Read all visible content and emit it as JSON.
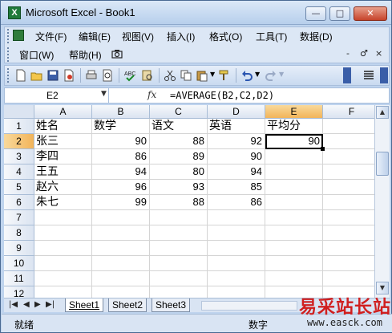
{
  "window": {
    "title": "Microsoft Excel - Book1",
    "minimize_label": "—",
    "restore_label": "□",
    "close_label": "✕",
    "app_icon_letter": "X"
  },
  "menu": {
    "row1": [
      "文件(F)",
      "编辑(E)",
      "视图(V)",
      "插入(I)",
      "格式(O)",
      "工具(T)",
      "数据(D)"
    ],
    "row2": [
      "窗口(W)",
      "帮助(H)"
    ],
    "doc_controls": [
      "-",
      "♂",
      "×"
    ]
  },
  "toolbar": {
    "icons": [
      "new-icon",
      "open-icon",
      "save-icon",
      "permission-icon",
      "print-icon",
      "print-preview-icon",
      "spelling-icon",
      "research-icon",
      "cut-icon",
      "copy-icon",
      "paste-icon",
      "format-painter-icon",
      "undo-icon",
      "redo-icon",
      "align-icon"
    ]
  },
  "formula_bar": {
    "name_box": "E2",
    "fx_label": "fx",
    "formula": "=AVERAGE(B2,C2,D2)"
  },
  "sheet": {
    "columns": [
      "A",
      "B",
      "C",
      "D",
      "E",
      "F"
    ],
    "active_column": "E",
    "active_row": "2",
    "row_numbers": [
      "1",
      "2",
      "3",
      "4",
      "5",
      "6",
      "7",
      "8",
      "9",
      "10",
      "11",
      "12"
    ],
    "header_row": [
      "姓名",
      "数学",
      "语文",
      "英语",
      "平均分",
      ""
    ],
    "rows": [
      [
        "张三",
        "90",
        "88",
        "92",
        "90"
      ],
      [
        "李四",
        "86",
        "89",
        "90",
        ""
      ],
      [
        "王五",
        "94",
        "80",
        "94",
        ""
      ],
      [
        "赵六",
        "96",
        "93",
        "85",
        ""
      ],
      [
        "朱七",
        "99",
        "88",
        "86",
        ""
      ]
    ]
  },
  "tabs": {
    "nav": [
      "|◀",
      "◀",
      "▶",
      "▶|"
    ],
    "sheets": [
      "Sheet1",
      "Sheet2",
      "Sheet3"
    ],
    "active": "Sheet1"
  },
  "status": {
    "left": "就绪",
    "right": "数字"
  },
  "watermark": {
    "brand": "易采站长站",
    "url": "www.easck.com"
  }
}
